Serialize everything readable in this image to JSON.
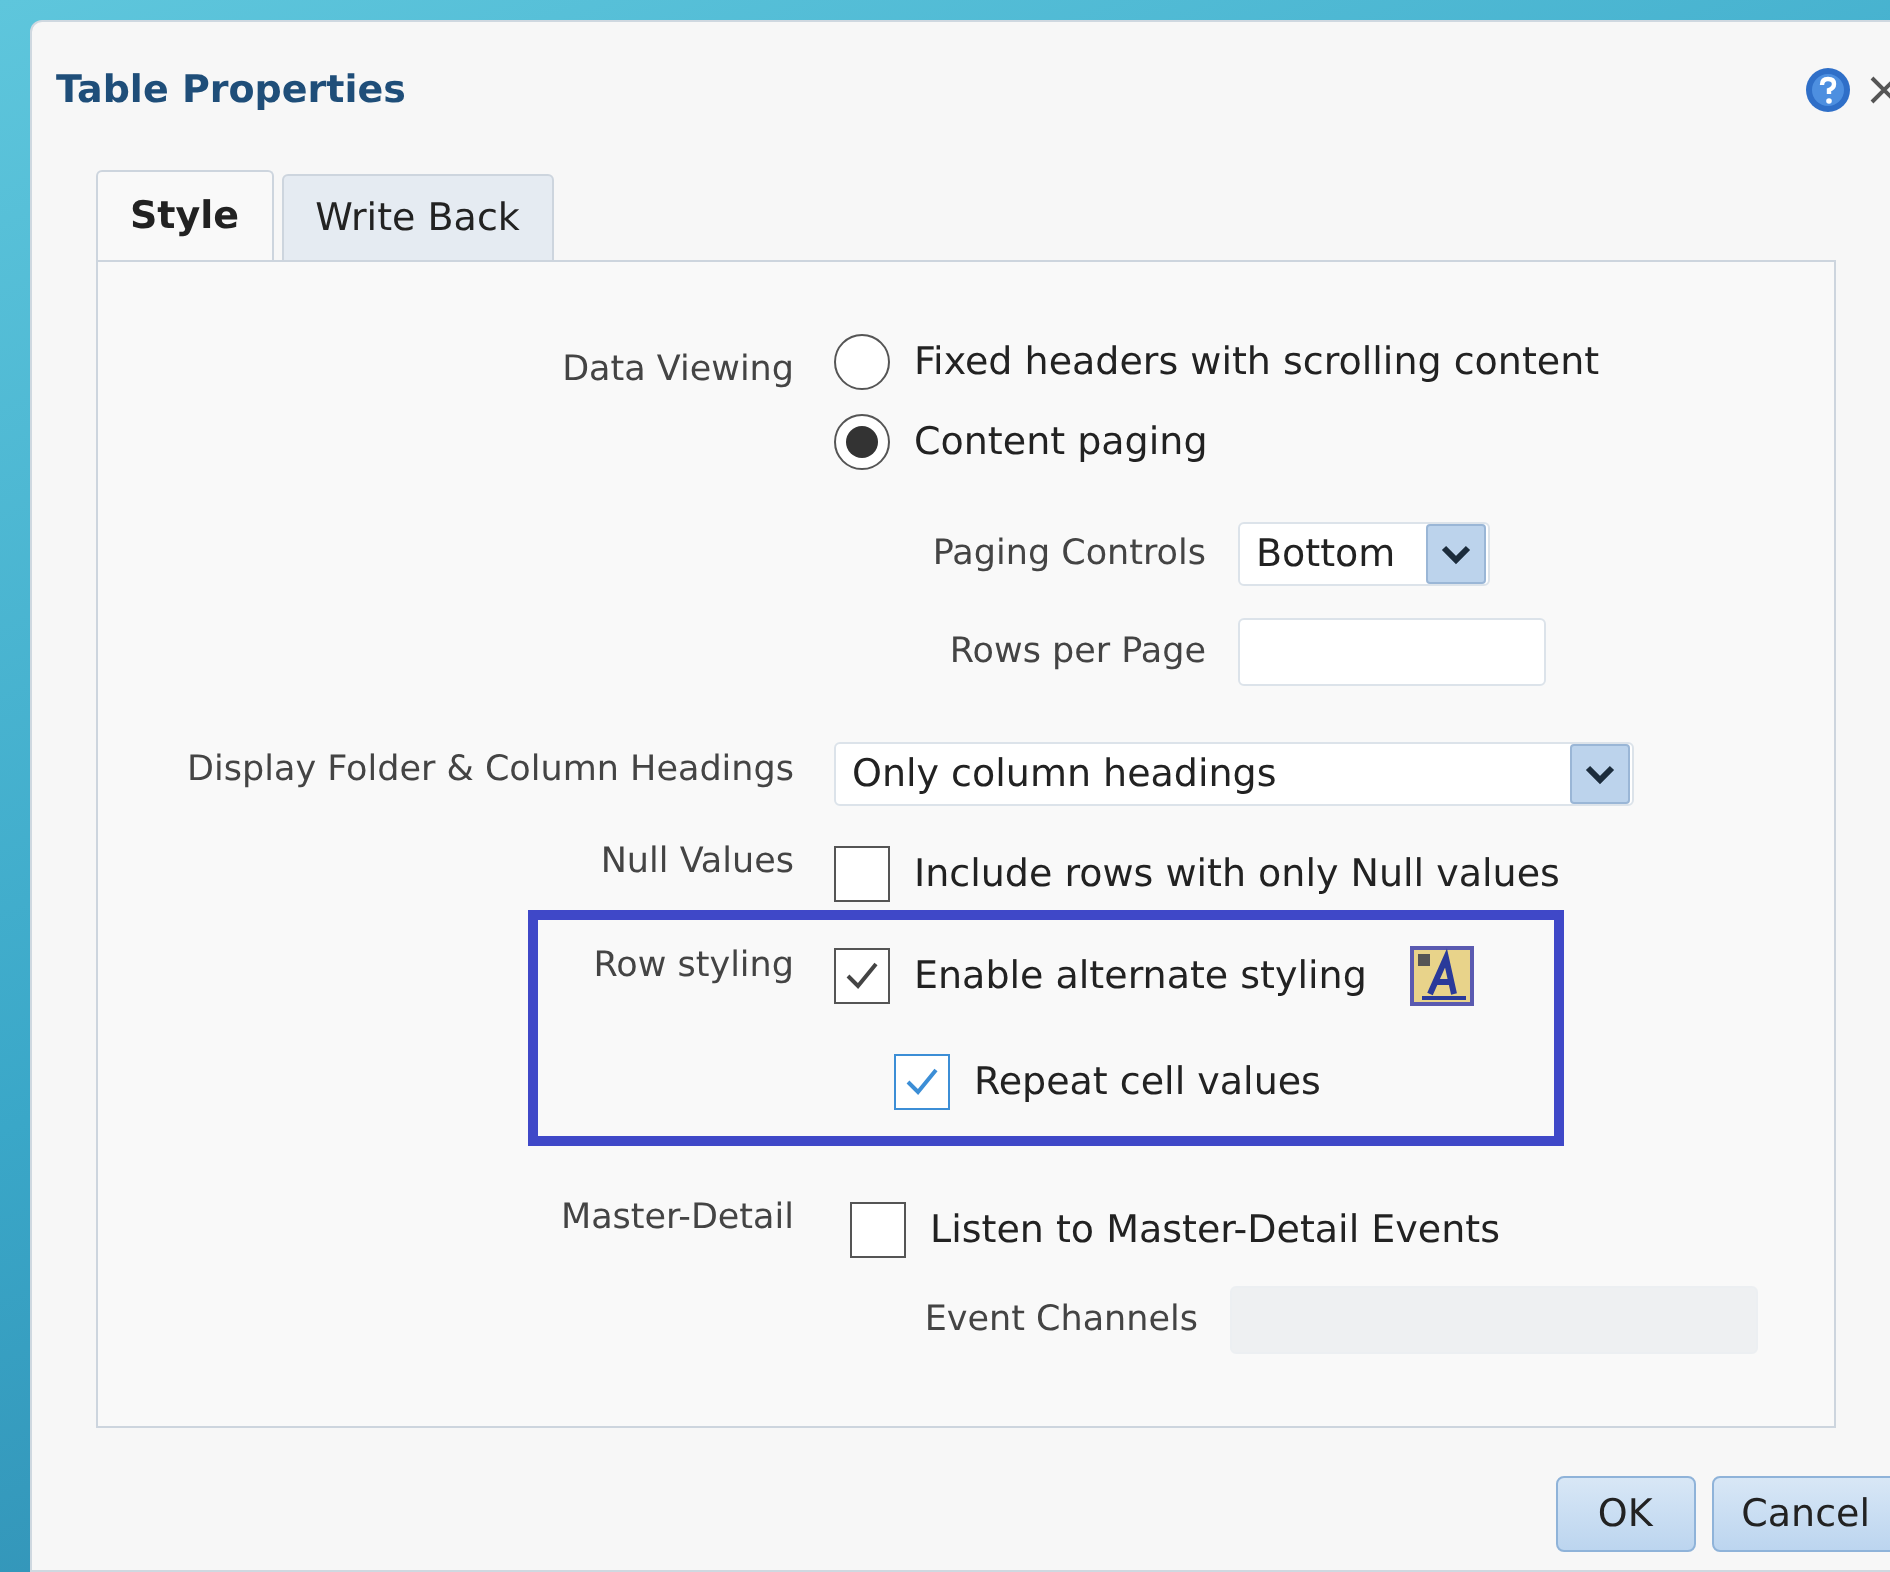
{
  "dialog": {
    "title": "Table Properties"
  },
  "tabs": [
    {
      "label": "Style",
      "selected": true
    },
    {
      "label": "Write Back",
      "selected": false
    }
  ],
  "data_viewing": {
    "label": "Data Viewing",
    "options": [
      {
        "label": "Fixed headers with scrolling content",
        "selected": false
      },
      {
        "label": "Content paging",
        "selected": true
      }
    ]
  },
  "paging_controls": {
    "label": "Paging Controls",
    "value": "Bottom"
  },
  "rows_per_page": {
    "label": "Rows per Page"
  },
  "headings": {
    "label": "Display Folder & Column Headings",
    "value": "Only column headings"
  },
  "null_values": {
    "label": "Null Values",
    "option": "Include rows with only Null values",
    "checked": false
  },
  "row_styling": {
    "label": "Row styling",
    "options": [
      {
        "label": "Enable alternate styling",
        "checked": true,
        "focused": false
      },
      {
        "label": "Repeat cell values",
        "checked": true,
        "focused": true
      }
    ]
  },
  "master_detail": {
    "label": "Master-Detail",
    "option": "Listen to Master-Detail Events",
    "checked": false
  },
  "event_channels": {
    "label": "Event Channels",
    "disabled": true
  },
  "buttons": [
    "OK",
    "Cancel"
  ]
}
